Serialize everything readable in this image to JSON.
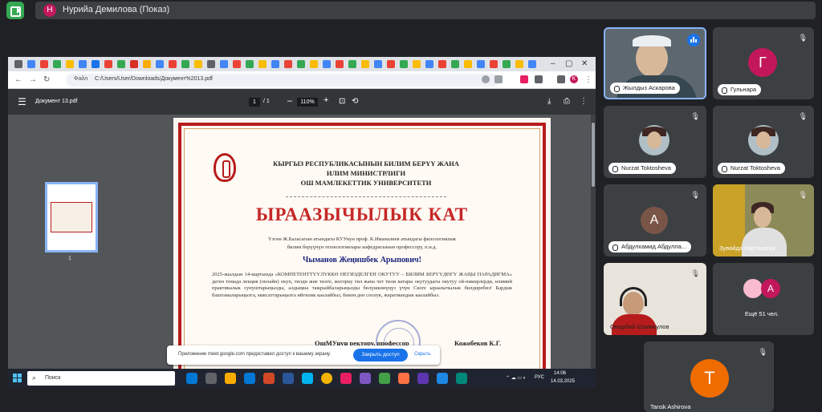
{
  "meet": {
    "presenter_initial": "Н",
    "presenter_text": "Нурийа Демилова (Показ)"
  },
  "browser": {
    "url_site": "Файл",
    "url_path": "C:/Users/User/Downloads/Документ%2013.pdf",
    "profile_initial": "K"
  },
  "pdf": {
    "title": "Документ 13.pdf",
    "page_current": "1",
    "page_total": "/ 1",
    "zoom": "110%",
    "thumb_number": "1"
  },
  "certificate": {
    "header_line1": "КЫРГЫЗ РЕСПУБЛИКАСЫНЫН БИЛИМ БЕРҮҮ ЖАНА",
    "header_line2": "ИЛИМ МИНИСТРЛИГИ",
    "header_line3": "ОШ МАМЛЕКЕТТИК УНИВЕРСИТЕТИ",
    "title": "ЫРААЗЫЧЫЛЫК КАТ",
    "intro_line1": "Үзгөн Ж.Баласагын атындагы КУУнун проф. К.Иманалиев атындагы филологиялык",
    "intro_line2": "билим берүүнүн технологиялары кафедрасынын профессору, п.и.д.",
    "name": "Чыманов Жеңишбек Арыпович!",
    "body": "2025-жылдын 14-мартында «КОМПЕТЕНТТҮҮЛҮККӨ НЕГИЗДЕЛГЕН ОКУТУУ – БИЛИМ БЕРҮҮДӨГҮ ЖАҢЫ ПАРАДИГМА» деген темада лекция (онлайн) окуп, тилди жне тилге, жогорку тил жана чет тили катары окутуудагы окутуу ой-пикирлерди, илимий практикалык сунуштарыңызды, алдыңкы тажрыйбаларыңызды бөлүшкөнүңүз үчүн Сизге ыраазычылык билдиребиз! Бардык баштамаларыңызга, максаттарыңызга ийгилик каалайбыз, бекем ден соолук, жаратмандык каалайбыз.",
    "rector": "ОшМУнун ректору, профессор",
    "signatory": "Кожобеков К.Г."
  },
  "notification": {
    "text": "Приложение meet.google.com предоставил доступ к вашему экрану.",
    "button": "Закрыть доступ",
    "hide": "Скрыть"
  },
  "taskbar": {
    "search": "Поиск",
    "lang": "РУС",
    "time": "14:06",
    "date": "14.03.2025"
  },
  "participants": [
    {
      "name": "Жылдыз Аскарова",
      "type": "photo",
      "state": "speaking"
    },
    {
      "name": "Гульнара",
      "initial": "Г",
      "color": "#c2185b",
      "state": "muted"
    },
    {
      "name": "Nurzat Toktosheva",
      "type": "photo",
      "state": "muted"
    },
    {
      "name": "Nurzat Toktosheva",
      "type": "photo",
      "state": "muted"
    },
    {
      "name": "Абдулхамид Абдулла...",
      "initial": "А",
      "color": "#795548",
      "state": "muted"
    },
    {
      "name": "Зувайда Карташева",
      "type": "photo",
      "state": "muted"
    },
    {
      "name": "Омурбай Шаимкулов",
      "type": "photo",
      "state": "muted"
    },
    {
      "name": "Ещё 51 чел.",
      "initial": "А",
      "color": "#c2185b",
      "state": "more"
    },
    {
      "name": "Tansk Ashirova",
      "initial": "T",
      "color": "#ef6c00",
      "state": "muted"
    }
  ],
  "icons": {
    "mic_off": "🎙",
    "menu": "☰"
  }
}
